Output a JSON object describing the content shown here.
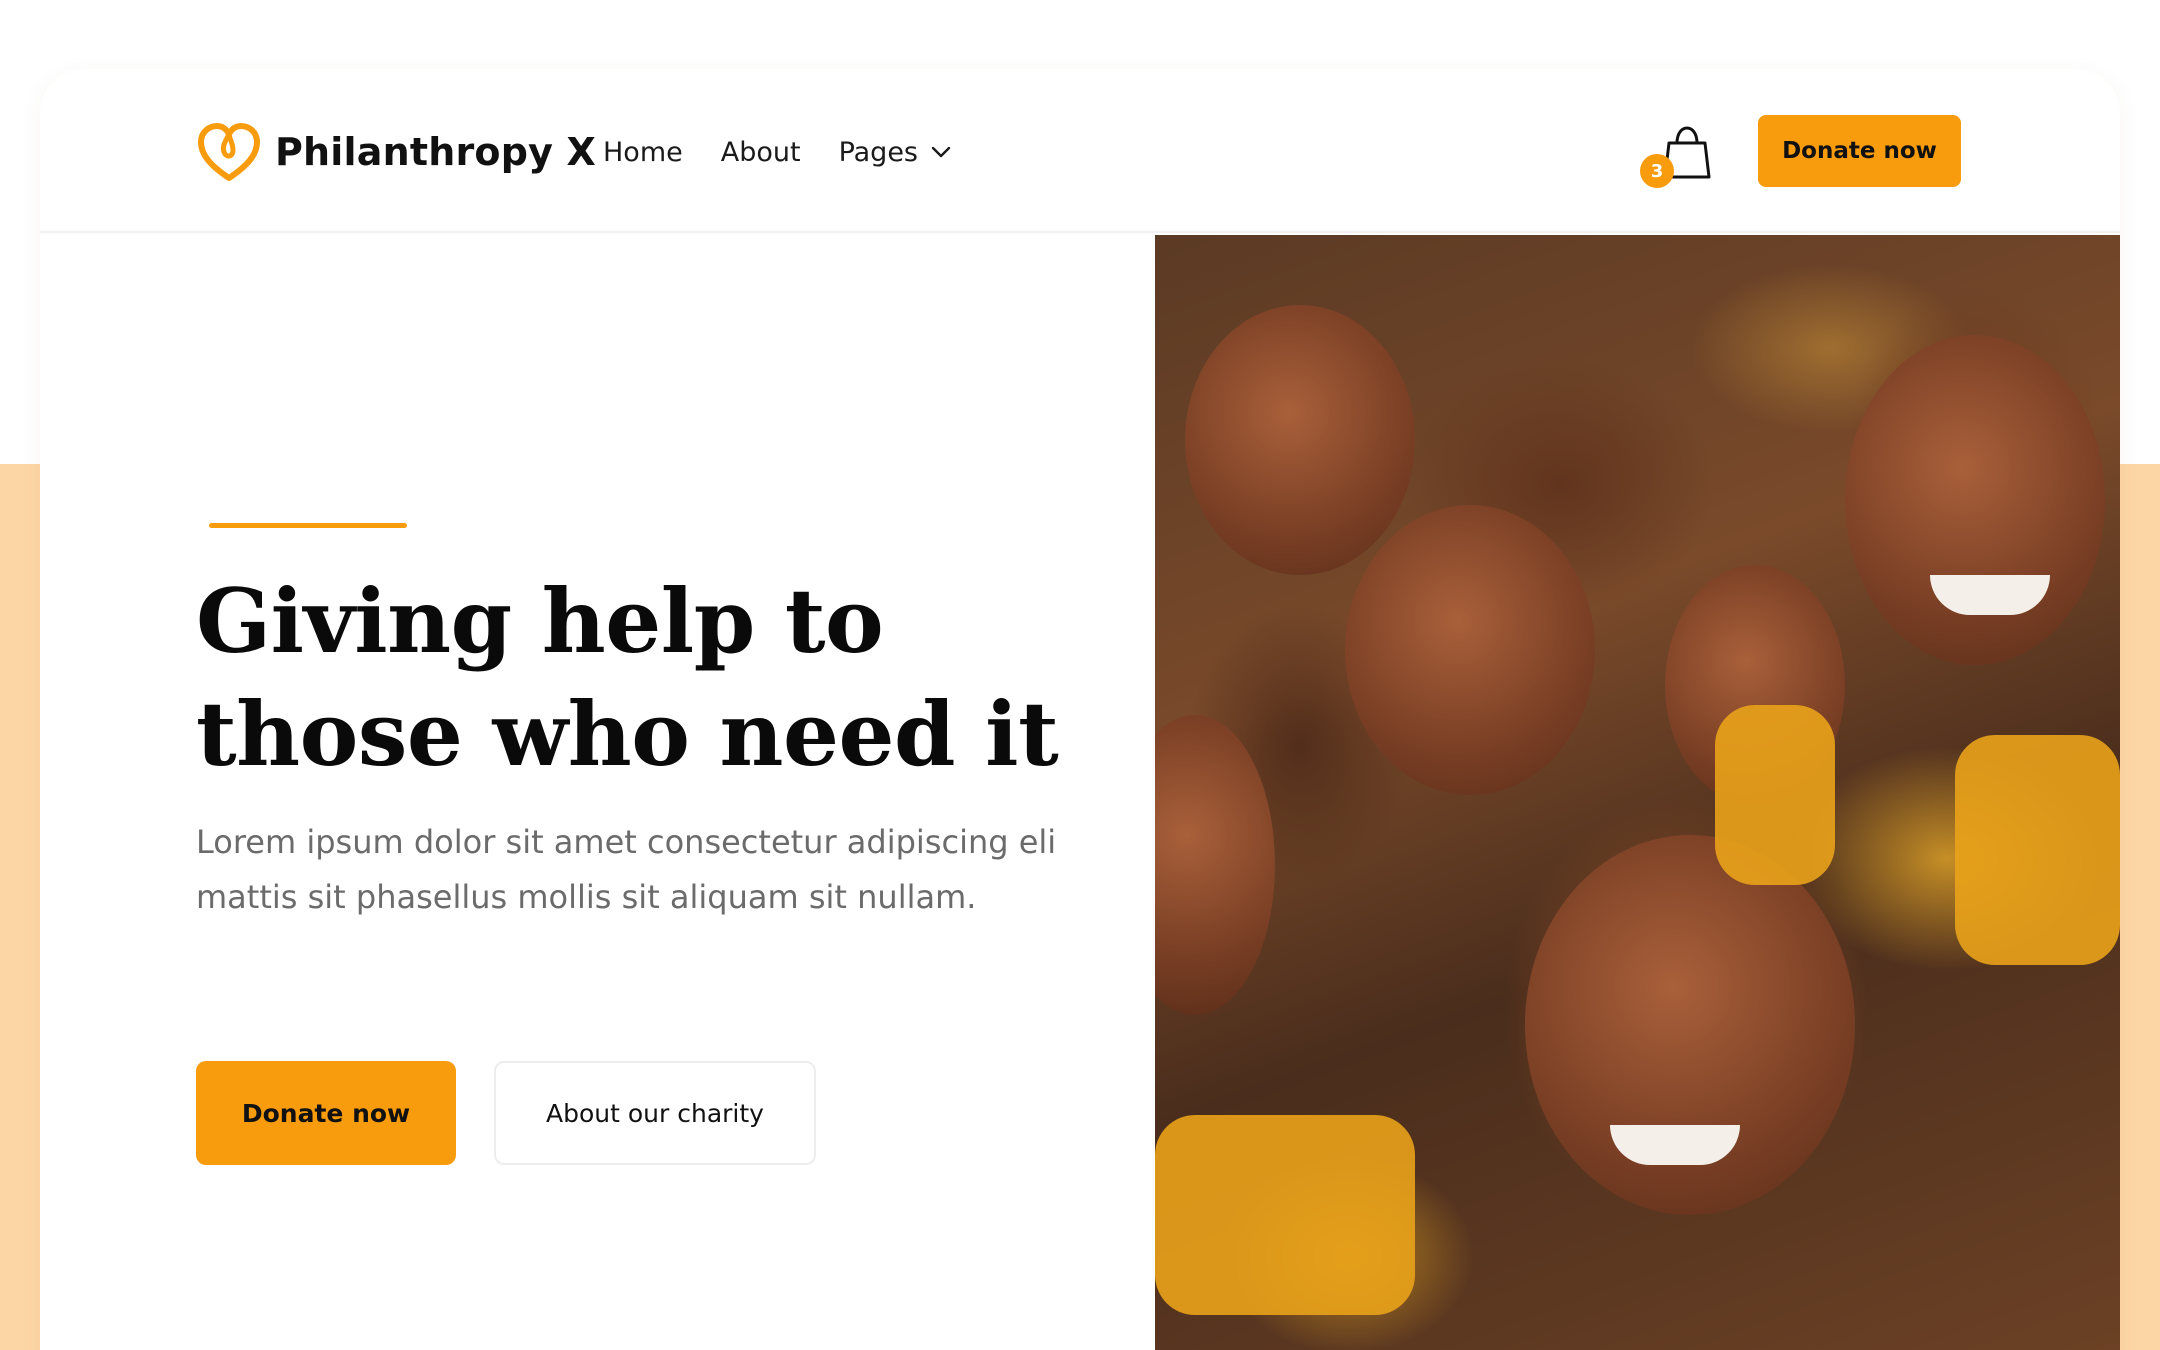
{
  "brand": {
    "name": "Philanthropy X",
    "logo_icon": "heart-icon",
    "accent_color": "#F89B0C"
  },
  "nav": {
    "items": [
      {
        "label": "Home"
      },
      {
        "label": "About"
      },
      {
        "label": "Pages",
        "icon": "chevron-down-icon"
      }
    ],
    "cart": {
      "icon": "shopping-bag-icon",
      "count": "3"
    },
    "donate_label": "Donate now"
  },
  "hero": {
    "title": "Giving help to those who need it",
    "subtitle": "Lorem ipsum dolor sit amet consectetur adipiscing eli mattis sit phasellus mollis sit aliquam sit nullam.",
    "primary_button": "Donate now",
    "secondary_button": "About our charity",
    "image_subject": "smiling children"
  },
  "colors": {
    "accent": "#F89B0C",
    "background_band": "#FDD6A6",
    "text_dark": "#0A0A0A",
    "text_muted": "#6B6B6B"
  }
}
